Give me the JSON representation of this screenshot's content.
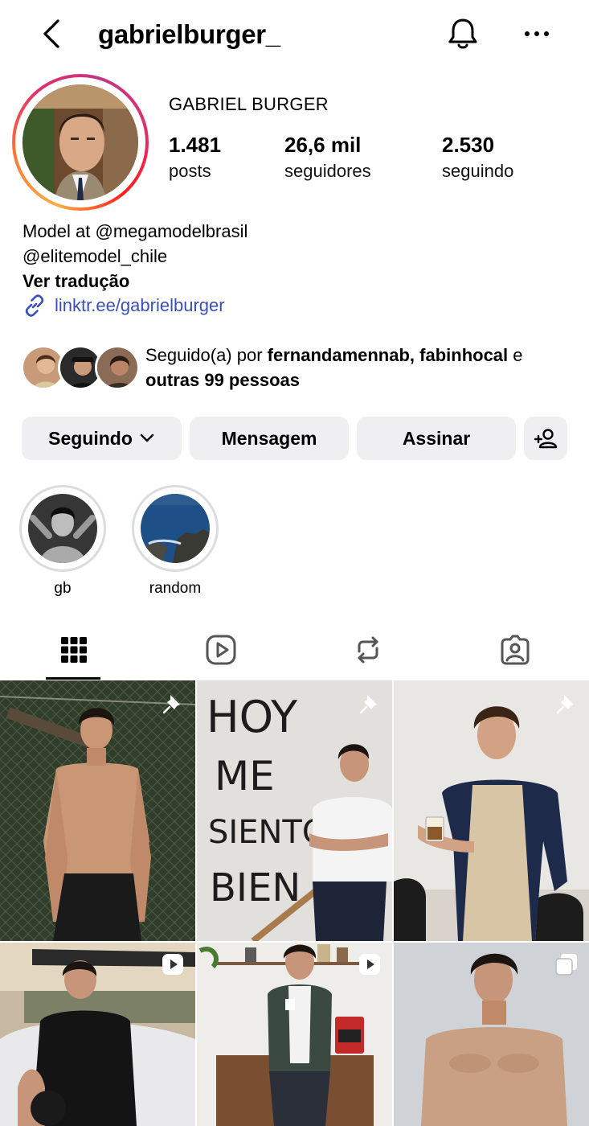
{
  "header": {
    "username": "gabrielburger_"
  },
  "profile": {
    "full_name": "GABRIEL BURGER",
    "stats": [
      {
        "value": "1.481",
        "label": "posts"
      },
      {
        "value": "26,6 mil",
        "label": "seguidores"
      },
      {
        "value": "2.530",
        "label": "seguindo"
      }
    ],
    "bio_lines": [
      "Model at @megamodelbrasil",
      "@elitemodel_chile"
    ],
    "translate_label": "Ver tradução",
    "link": "linktr.ee/gabrielburger"
  },
  "mutual": {
    "prefix": "Seguido(a) por ",
    "names": "fernandamennab, fabinhocal",
    "conjunction": " e ",
    "others": "outras 99 pessoas"
  },
  "actions": {
    "following_label": "Seguindo",
    "message_label": "Mensagem",
    "subscribe_label": "Assinar"
  },
  "highlights": [
    {
      "label": "gb"
    },
    {
      "label": "random"
    }
  ],
  "tabs": [
    "grid-icon",
    "reels-icon",
    "reposts-icon",
    "tagged-icon"
  ],
  "posts": [
    {
      "photo_text": [
        "HOY",
        "ME",
        "SIENTO",
        "BIEN"
      ]
    }
  ],
  "colors": {
    "link": "#3b4fb8",
    "button_bg": "#efeff1",
    "ring_gray": "#dcdcdf"
  }
}
